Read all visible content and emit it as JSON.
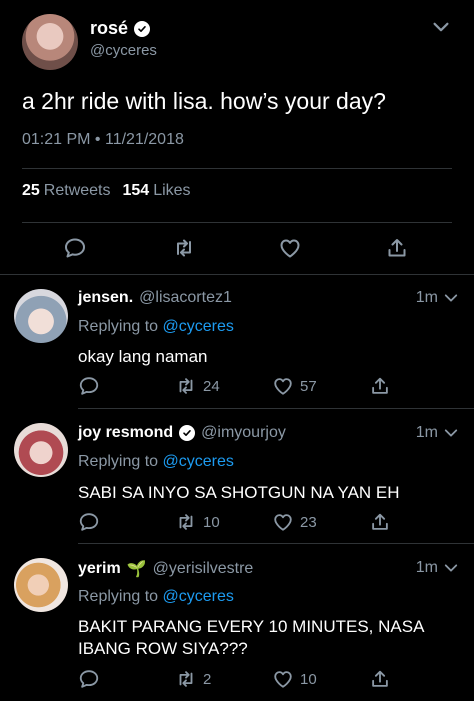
{
  "main_tweet": {
    "name": "rosé",
    "handle": "@cyceres",
    "text": "a 2hr ride with lisa. how’s your day?",
    "timestamp": "01:21 PM • 11/21/2018",
    "retweets_count": "25",
    "retweets_label": "Retweets",
    "likes_count": "154",
    "likes_label": "Likes"
  },
  "replies": [
    {
      "name": "jensen.",
      "handle": "@lisacortez1",
      "time": "1m",
      "replying_prefix": "Replying to",
      "replying_to": "@cyceres",
      "text": "okay lang naman",
      "retweets": "24",
      "likes": "57"
    },
    {
      "name": "joy resmond",
      "handle": "@imyourjoy",
      "time": "1m",
      "replying_prefix": "Replying to",
      "replying_to": "@cyceres",
      "text": "SABI SA INYO SA SHOTGUN NA YAN EH",
      "retweets": "10",
      "likes": "23"
    },
    {
      "name": "yerim",
      "name_emoji": "🌱",
      "handle": "@yerisilvestre",
      "time": "1m",
      "replying_prefix": "Replying to",
      "replying_to": "@cyceres",
      "text": "BAKIT PARANG EVERY 10 MINUTES, NASA IBANG ROW SIYA???",
      "retweets": "2",
      "likes": "10"
    }
  ],
  "colors": {
    "background": "#000000",
    "secondary_text": "#8b98a5",
    "link": "#1d9bf0",
    "divider": "#2f3336"
  },
  "icons": [
    "chevron-down-icon",
    "verified-badge-icon",
    "reply-icon",
    "retweet-icon",
    "like-icon",
    "share-icon",
    "sprout-emoji"
  ]
}
